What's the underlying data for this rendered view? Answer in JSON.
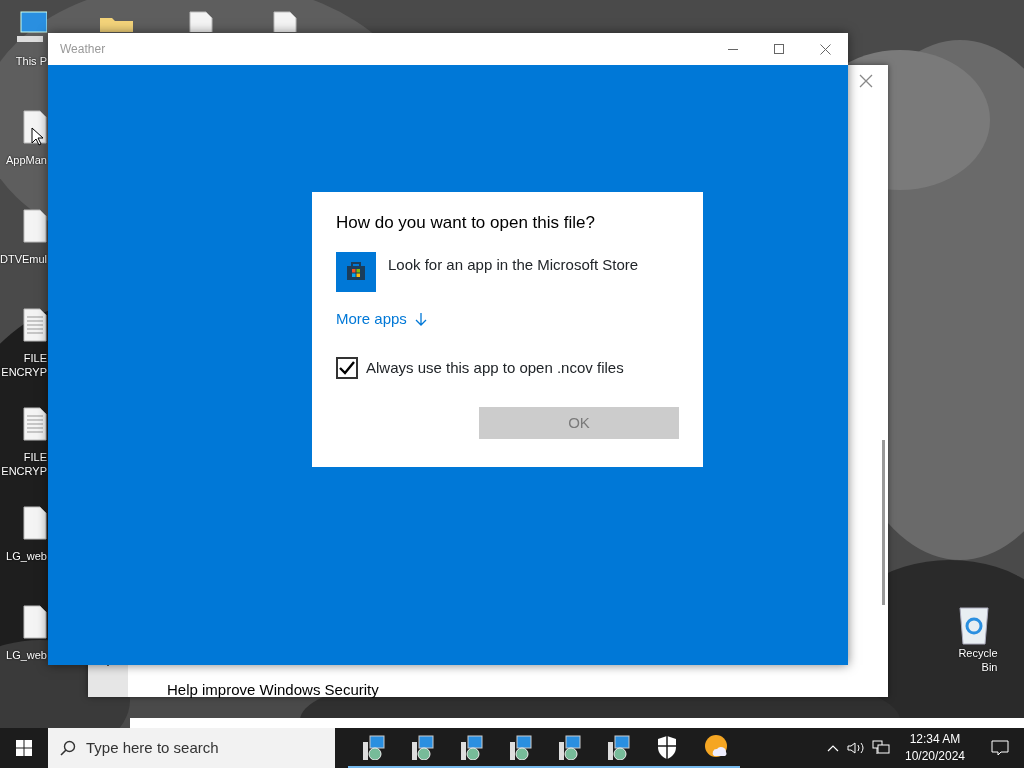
{
  "desktop_icons": [
    {
      "kind": "pc",
      "label": "This P"
    },
    {
      "kind": "file",
      "label": "AppMan"
    },
    {
      "kind": "file",
      "label": "DTVEmul"
    },
    {
      "kind": "text",
      "label": "FILE ENCRYP"
    },
    {
      "kind": "text",
      "label": "FILE ENCRYP"
    },
    {
      "kind": "file",
      "label": "LG_web"
    },
    {
      "kind": "file",
      "label": "LG_web"
    }
  ],
  "top_icons": [
    {
      "kind": "folder"
    },
    {
      "kind": "file"
    },
    {
      "kind": "file"
    }
  ],
  "recycle_bin": {
    "label": "Recycle Bin"
  },
  "security_window": {
    "help_text": "Help improve Windows Security"
  },
  "weather_window": {
    "title": "Weather",
    "dialog": {
      "heading": "How do you want to open this file?",
      "store_option": "Look for an app in the Microsoft Store",
      "more_apps": "More apps",
      "always_use": {
        "label": "Always use this app to open .ncov files",
        "checked": true
      },
      "ok_button": {
        "label": "OK",
        "disabled": true
      }
    }
  },
  "taskbar": {
    "search_placeholder": "Type here to search",
    "apps": [
      {
        "kind": "installer",
        "running": true
      },
      {
        "kind": "installer",
        "running": true
      },
      {
        "kind": "installer",
        "running": true
      },
      {
        "kind": "installer",
        "running": true
      },
      {
        "kind": "installer",
        "running": true
      },
      {
        "kind": "installer",
        "running": true
      },
      {
        "kind": "shield",
        "running": true
      },
      {
        "kind": "weather",
        "running": true
      }
    ],
    "time": "12:34 AM",
    "date": "10/20/2024"
  }
}
